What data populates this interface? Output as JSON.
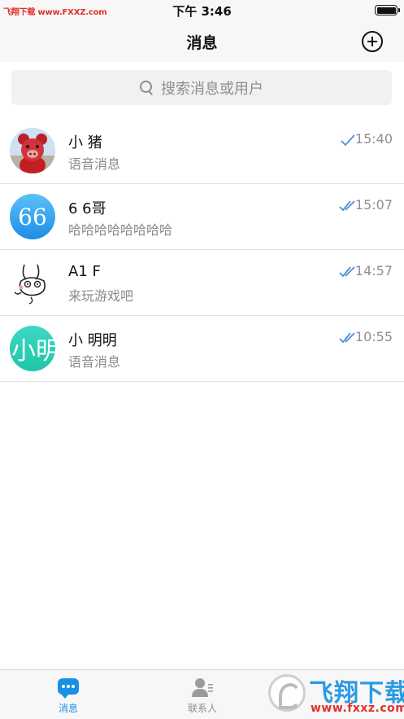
{
  "status_bar": {
    "watermark": "飞翔下载 www.FXXZ.com",
    "time": "下午 3:46",
    "battery_level": 1.0
  },
  "nav": {
    "title": "消息",
    "add_icon": "plus-circle-icon"
  },
  "search": {
    "placeholder": "搜索消息或用户",
    "icon": "search-icon"
  },
  "conversations": [
    {
      "name": "小 猪",
      "preview": "语音消息",
      "time": "15:40",
      "read_status": "sent",
      "avatar": "pig-photo"
    },
    {
      "name": "6 6哥",
      "preview": "哈哈哈哈哈哈哈哈",
      "time": "15:07",
      "read_status": "read",
      "avatar_text": "66",
      "avatar_color": "#1d8de7"
    },
    {
      "name": "A1 F",
      "preview": "来玩游戏吧",
      "time": "14:57",
      "read_status": "read",
      "avatar": "bunny-sketch"
    },
    {
      "name": "小 明明",
      "preview": "语音消息",
      "time": "10:55",
      "read_status": "read",
      "avatar_text": "小明",
      "avatar_color": "#1fc5a7"
    }
  ],
  "tab_bar": {
    "tabs": [
      {
        "label": "消息",
        "icon": "chat-bubble-icon",
        "active": true
      },
      {
        "label": "联系人",
        "icon": "contacts-icon",
        "active": false
      }
    ],
    "accent": "#1a8fe6"
  },
  "logo": {
    "name": "飞翔下载",
    "url": "www.fxxz.com"
  },
  "colors": {
    "accent": "#1a8fe6",
    "check": "#4a90d9",
    "secondary_text": "#8e8e93"
  }
}
